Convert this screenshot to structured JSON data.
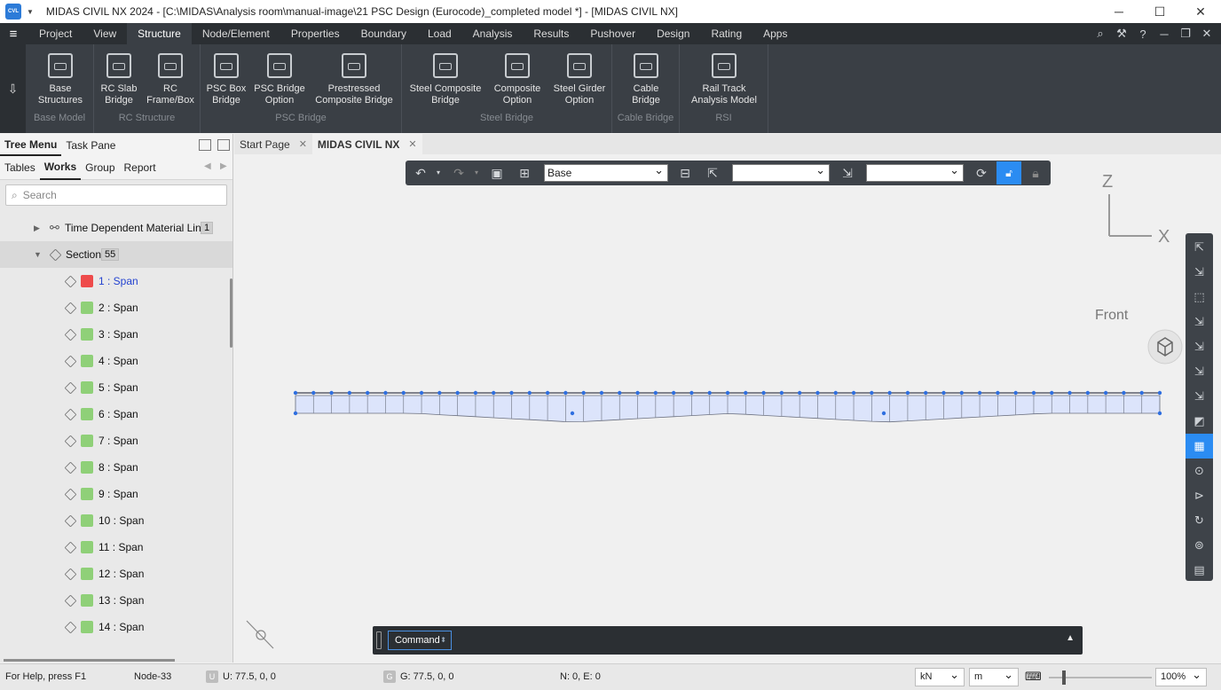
{
  "window": {
    "logo": "CVL",
    "title": "MIDAS CIVIL NX 2024 - [C:\\MIDAS\\Analysis room\\manual-image\\21 PSC Design (Eurocode)_completed model *] - [MIDAS CIVIL NX]",
    "minimize": "─",
    "maximize": "☐",
    "close": "✕"
  },
  "menu": {
    "tabs": [
      "Project",
      "View",
      "Structure",
      "Node/Element",
      "Properties",
      "Boundary",
      "Load",
      "Analysis",
      "Results",
      "Pushover",
      "Design",
      "Rating",
      "Apps"
    ],
    "active": "Structure"
  },
  "ribbon": {
    "groups": [
      {
        "label": "Base Model",
        "buttons": [
          {
            "line1": "Base",
            "line2": "Structures"
          }
        ]
      },
      {
        "label": "RC Structure",
        "buttons": [
          {
            "line1": "RC Slab",
            "line2": "Bridge"
          },
          {
            "line1": "RC",
            "line2": "Frame/Box"
          }
        ]
      },
      {
        "label": "PSC Bridge",
        "buttons": [
          {
            "line1": "PSC Box",
            "line2": "Bridge"
          },
          {
            "line1": "PSC Bridge",
            "line2": "Option"
          },
          {
            "line1": "Prestressed",
            "line2": "Composite Bridge"
          }
        ]
      },
      {
        "label": "Steel Bridge",
        "buttons": [
          {
            "line1": "Steel Composite",
            "line2": "Bridge"
          },
          {
            "line1": "Composite",
            "line2": "Option"
          },
          {
            "line1": "Steel Girder",
            "line2": "Option"
          }
        ]
      },
      {
        "label": "Cable Bridge",
        "buttons": [
          {
            "line1": "Cable",
            "line2": "Bridge"
          }
        ]
      },
      {
        "label": "RSI",
        "buttons": [
          {
            "line1": "Rail Track",
            "line2": "Analysis Model"
          }
        ]
      }
    ]
  },
  "panel": {
    "tabs": [
      "Tree Menu",
      "Task Pane"
    ],
    "subtabs": [
      "Tables",
      "Works",
      "Group",
      "Report"
    ],
    "search_placeholder": "Search",
    "tdml": {
      "label": "Time Dependent Material Link",
      "count": "1"
    },
    "section": {
      "label": "Section",
      "count": "55"
    },
    "items": [
      "1 : Span",
      "2 : Span",
      "3 : Span",
      "4 : Span",
      "5 : Span",
      "6 : Span",
      "7 : Span",
      "8 : Span",
      "9 : Span",
      "10 : Span",
      "11 : Span",
      "12 : Span",
      "13 : Span",
      "14 : Span"
    ],
    "colors": {
      "selected": "#ee4b4b",
      "normal": "#8fd078"
    }
  },
  "doc_tabs": [
    "Start Page",
    "MIDAS CIVIL NX"
  ],
  "view_toolbar": {
    "select1": "Base",
    "select2": "",
    "select3": ""
  },
  "axis": {
    "z": "Z",
    "x": "X",
    "front": "Front"
  },
  "command": {
    "label": "Command"
  },
  "status": {
    "help": "For Help, press F1",
    "node": "Node-33",
    "u_badge": "U",
    "u": "U: 77.5, 0, 0",
    "g_badge": "G",
    "g": "G: 77.5, 0, 0",
    "ne": "N: 0, E: 0",
    "force_unit": "kN",
    "length_unit": "m",
    "zoom": "100%"
  }
}
